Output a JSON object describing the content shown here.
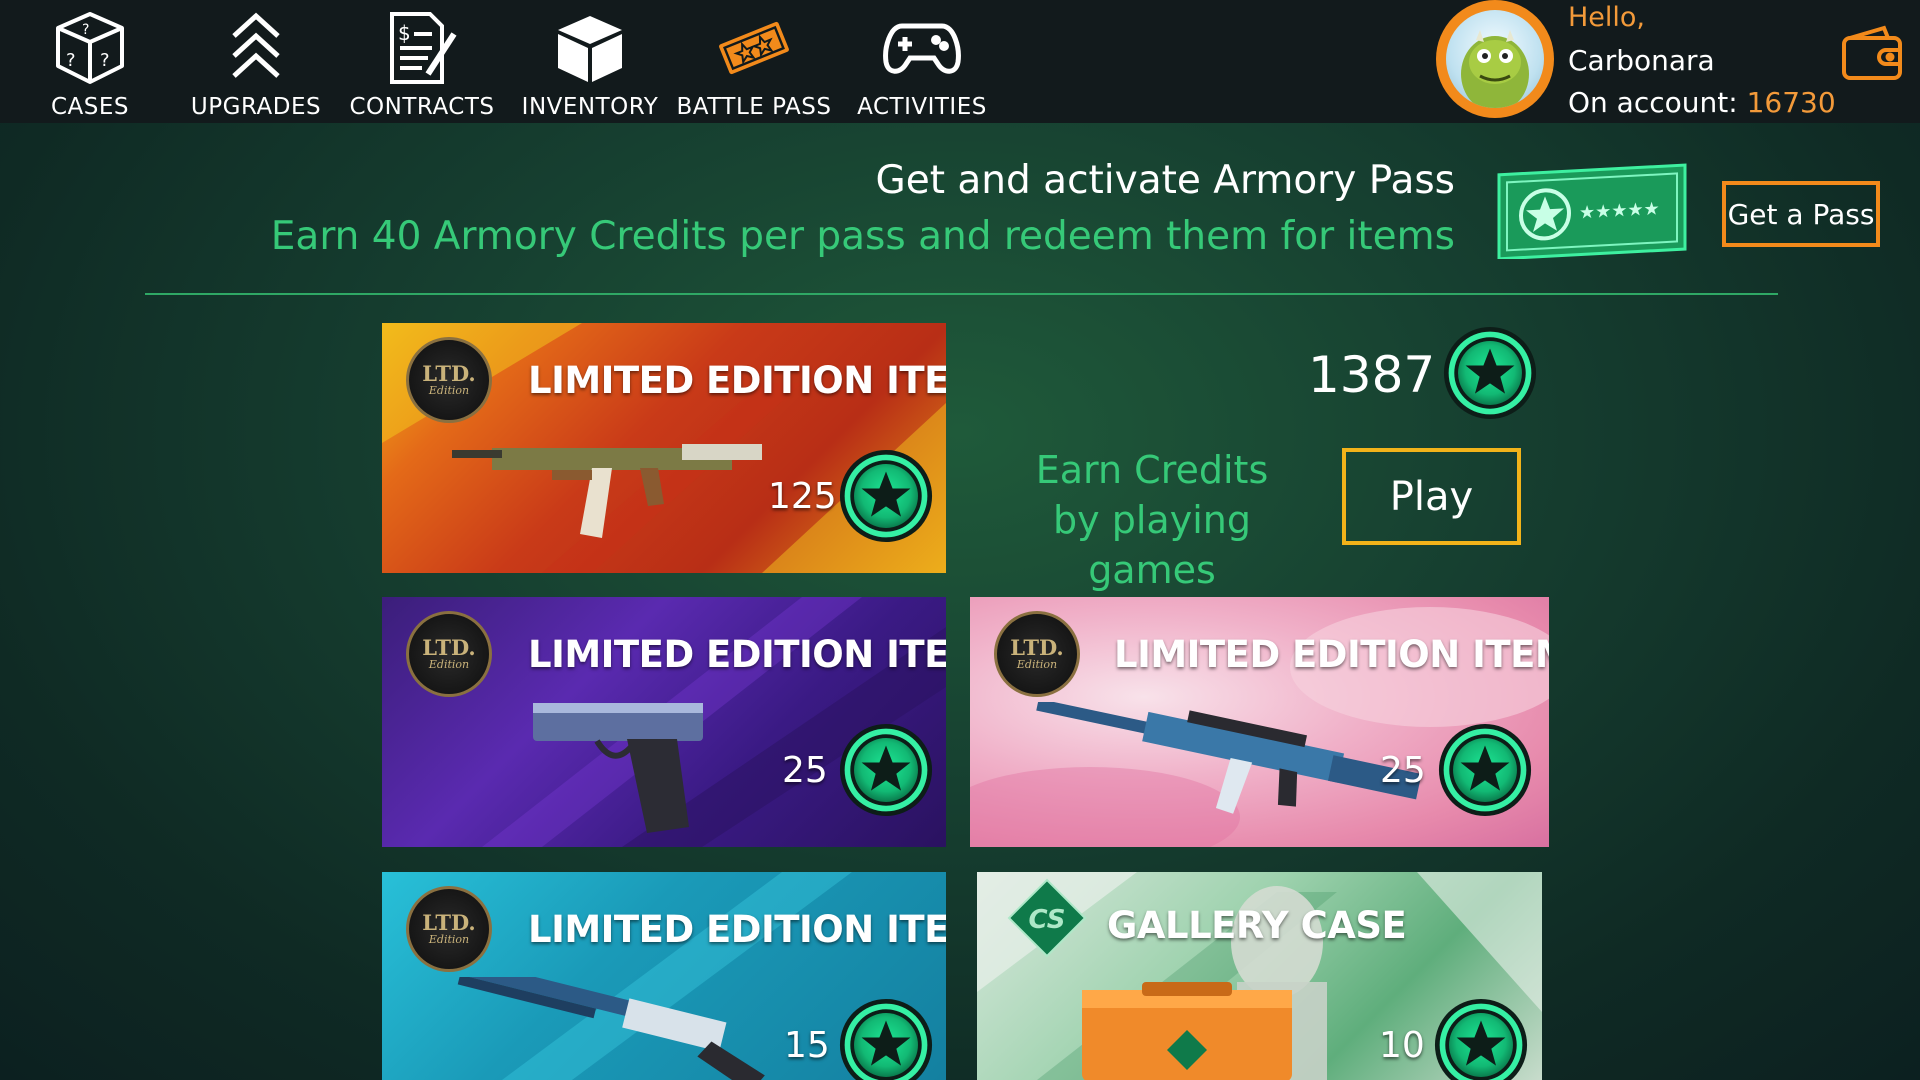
{
  "nav": {
    "items": [
      {
        "label": "CASES",
        "icon": "dice-icon"
      },
      {
        "label": "UPGRADES",
        "icon": "chevrons-up-icon"
      },
      {
        "label": "CONTRACTS",
        "icon": "contract-icon"
      },
      {
        "label": "INVENTORY",
        "icon": "box-icon"
      },
      {
        "label": "BATTLE PASS",
        "icon": "ticket-icon"
      },
      {
        "label": "ACTIVITIES",
        "icon": "gamepad-icon"
      }
    ]
  },
  "user": {
    "greeting": "Hello,",
    "name": "Carbonara",
    "account_label": "On account: ",
    "balance": "16730"
  },
  "banner": {
    "title": "Get and activate Armory Pass",
    "subtitle": "Earn 40 Armory Credits per pass and redeem them for items",
    "button": "Get a Pass"
  },
  "credits": {
    "value": "1387",
    "earn_text": "Earn Credits by playing games",
    "play_button": "Play"
  },
  "cards": [
    {
      "title": "LIMITED EDITION ITEM",
      "price": "125",
      "badge_l1": "LTD.",
      "badge_l2": "Edition"
    },
    {
      "title": "LIMITED EDITION ITEM",
      "price": "25",
      "badge_l1": "LTD.",
      "badge_l2": "Edition"
    },
    {
      "title": "LIMITED EDITION ITEM",
      "price": "25",
      "badge_l1": "LTD.",
      "badge_l2": "Edition"
    },
    {
      "title": "LIMITED EDITION ITEM",
      "price": "15",
      "badge_l1": "LTD.",
      "badge_l2": "Edition"
    },
    {
      "title": "GALLERY CASE",
      "price": "10",
      "badge_l1": "CS"
    }
  ],
  "colors": {
    "accent_orange": "#f28a1b",
    "accent_green": "#36c978",
    "play_border": "#f2b31a",
    "coin_green": "#1fd68c"
  }
}
